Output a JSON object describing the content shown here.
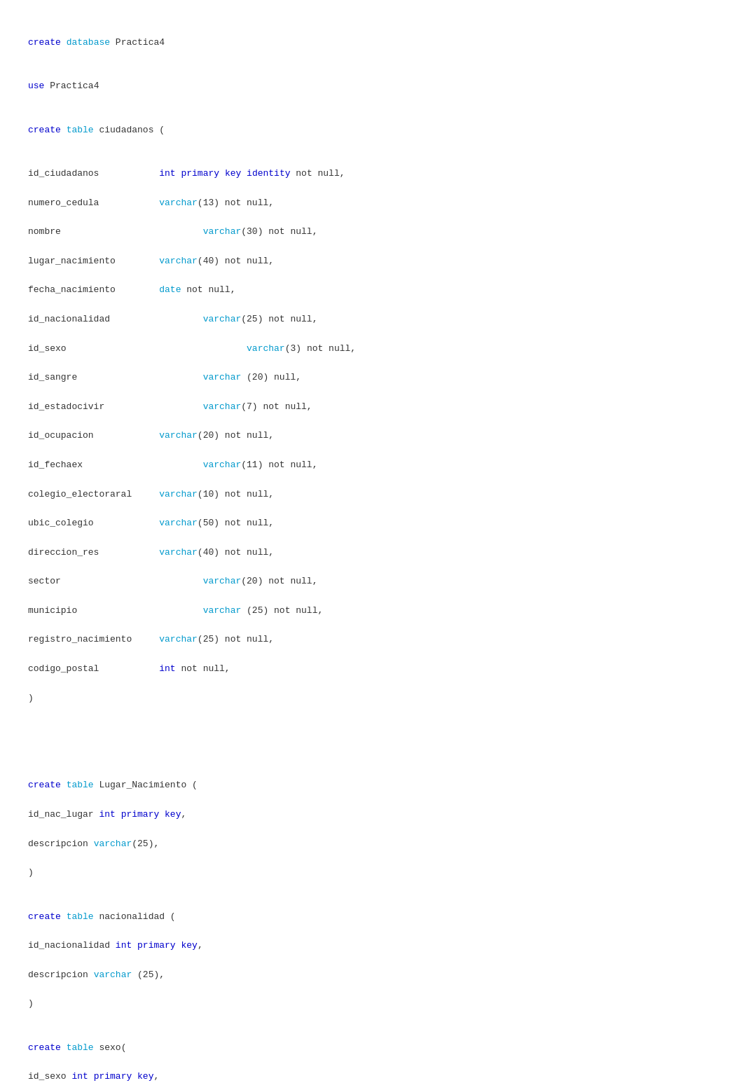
{
  "code": {
    "lines": []
  }
}
